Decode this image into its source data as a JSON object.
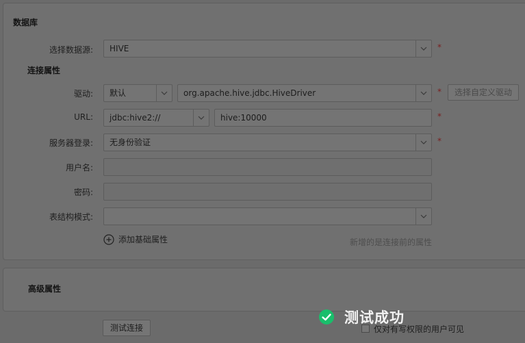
{
  "database_section": {
    "title": "数据库"
  },
  "datasource": {
    "label": "选择数据源:",
    "value": "HIVE"
  },
  "connection_section": {
    "title": "连接属性"
  },
  "driver": {
    "label": "驱动:",
    "mode_value": "默认",
    "class_value": "org.apache.hive.jdbc.HiveDriver",
    "custom_button": "选择自定义驱动"
  },
  "url": {
    "label": "URL:",
    "prefix_value": "jdbc:hive2://",
    "host_value": "hive:10000"
  },
  "server_login": {
    "label": "服务器登录:",
    "value": "无身份验证"
  },
  "username": {
    "label": "用户名:",
    "value": ""
  },
  "password": {
    "label": "密码:",
    "value": ""
  },
  "schema_mode": {
    "label": "表结构模式:",
    "value": ""
  },
  "add_property": {
    "label": "添加基础属性",
    "hint": "新增的是连接前的属性"
  },
  "advanced_section": {
    "title": "高级属性"
  },
  "test_button": {
    "label": "测试连接"
  },
  "toast": {
    "message": "测试成功",
    "color": "#19be6b"
  },
  "visibility": {
    "label": "仅对有写权限的用户可见",
    "checked": false
  },
  "required_mark": "*"
}
